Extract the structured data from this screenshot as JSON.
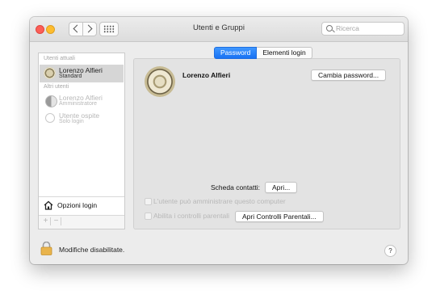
{
  "window": {
    "title": "Utenti e Gruppi"
  },
  "search": {
    "placeholder": "Ricerca"
  },
  "sidebar": {
    "current_users_label": "Utenti attuali",
    "current_user": {
      "name": "Lorenzo Alfieri",
      "role": "Standard"
    },
    "other_users_label": "Altri utenti",
    "other_users": [
      {
        "name": "Lorenzo Alfieri",
        "role": "Amministratore"
      },
      {
        "name": "Utente ospite",
        "role": "Solo login"
      }
    ],
    "login_options_label": "Opzioni login",
    "add_label": "+",
    "remove_label": "−"
  },
  "tabs": [
    {
      "label": "Password",
      "active": true
    },
    {
      "label": "Elementi login",
      "active": false
    }
  ],
  "main": {
    "user_name": "Lorenzo Alfieri",
    "change_password_button": "Cambia password...",
    "contact_card_label": "Scheda contatti:",
    "open_button": "Apri...",
    "allow_admin_label": "L'utente può amministrare questo computer",
    "parental_controls_label": "Abilita i controlli parentali",
    "open_parental_button": "Apri Controlli Parentali..."
  },
  "footer": {
    "lock_label": "Modifiche disabilitate.",
    "help_label": "?"
  }
}
